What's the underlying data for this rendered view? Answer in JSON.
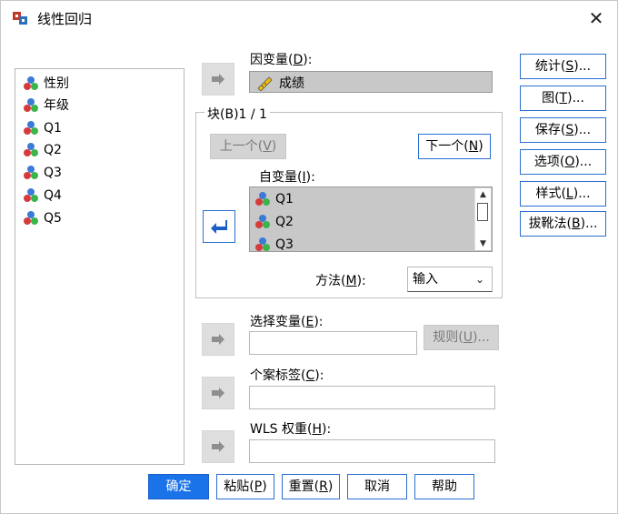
{
  "window": {
    "title": "线性回归"
  },
  "variables": [
    "性别",
    "年级",
    "Q1",
    "Q2",
    "Q3",
    "Q4",
    "Q5"
  ],
  "dependent": {
    "label_pre": "因变量(",
    "key": "D",
    "label_post": "):",
    "value": "成绩"
  },
  "block": {
    "label": "块(B)1 / 1",
    "prev_pre": "上一个(",
    "prev_key": "V",
    "prev_post": ")",
    "next_pre": "下一个(",
    "next_key": "N",
    "next_post": ")"
  },
  "independent": {
    "label_pre": "自变量(",
    "key": "I",
    "label_post": "):",
    "items": [
      "Q1",
      "Q2",
      "Q3"
    ]
  },
  "method": {
    "label_pre": "方法(",
    "key": "M",
    "label_post": "):",
    "value": "输入"
  },
  "selection": {
    "label_pre": "选择变量(",
    "key": "E",
    "label_post": "):",
    "rule_pre": "规则(",
    "rule_key": "U",
    "rule_post": ")..."
  },
  "case_labels": {
    "label_pre": "个案标签(",
    "key": "C",
    "label_post": "):"
  },
  "wls": {
    "label_pre": "WLS 权重(",
    "key": "H",
    "label_post": "):"
  },
  "side_buttons": [
    {
      "pre": "统计(",
      "key": "S",
      "post": ")..."
    },
    {
      "pre": "图(",
      "key": "T",
      "post": ")..."
    },
    {
      "pre": "保存(",
      "key": "S",
      "post": ")..."
    },
    {
      "pre": "选项(",
      "key": "O",
      "post": ")..."
    },
    {
      "pre": "样式(",
      "key": "L",
      "post": ")..."
    },
    {
      "pre": "拔靴法(",
      "key": "B",
      "post": ")..."
    }
  ],
  "footer": {
    "ok": "确定",
    "paste_pre": "粘贴(",
    "paste_key": "P",
    "paste_post": ")",
    "reset_pre": "重置(",
    "reset_key": "R",
    "reset_post": ")",
    "cancel": "取消",
    "help": "帮助"
  },
  "colors": {
    "accent": "#1a73e8",
    "button_border": "#2a6fd1",
    "filled_field": "#c8c8c8",
    "disabled": "#d4d4d4"
  }
}
